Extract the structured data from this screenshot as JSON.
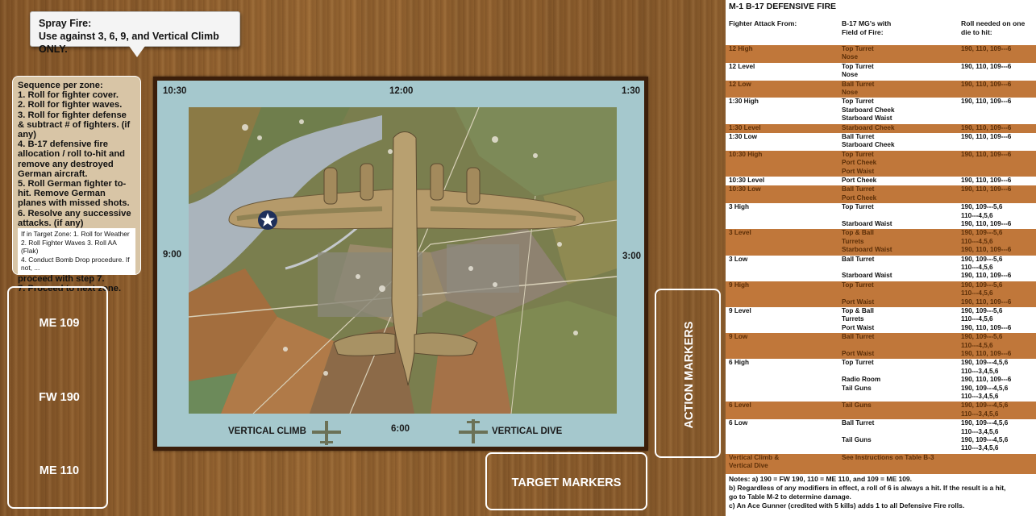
{
  "spray_fire": {
    "line1": "Spray Fire:",
    "line2": "Use against 3, 6, 9, and Vertical Climb ONLY."
  },
  "sequence": {
    "title": "Sequence per zone:",
    "steps": [
      "1. Roll for fighter cover.",
      "2. Roll for fighter waves.",
      "3. Roll for fighter defense & subtract # of fighters. (if any)",
      "4. B-17 defensive fire allocation / roll to-hit and remove any destroyed German aircraft.",
      "5. Roll German fighter to-hit. Remove German planes with missed shots.",
      "6. Resolve any successive attacks. (if any)"
    ],
    "sub": [
      "If in Target Zone:  1. Roll for Weather",
      "2. Roll Fighter Waves   3. Roll AA (Flak)",
      "4. Conduct Bomb Drop procedure. If not, ..."
    ],
    "after": [
      "proceed with step 7.",
      "7. Proceed to next zone."
    ]
  },
  "fighters": [
    "ME 109",
    "FW 190",
    "ME 110"
  ],
  "board": {
    "clock_1030": "10:30",
    "clock_1200": "12:00",
    "clock_130": "1:30",
    "clock_900": "9:00",
    "clock_300": "3:00",
    "clock_600": "6:00",
    "vertical_climb": "VERTICAL CLIMB",
    "vertical_dive": "VERTICAL DIVE"
  },
  "action_markers": "ACTION MARKERS",
  "target_markers": "TARGET MARKERS",
  "table": {
    "title": "M-1 B-17 DEFENSIVE FIRE",
    "headers": {
      "col1": "Fighter Attack From:",
      "col2a": "B-17 MG's with",
      "col2b": "Field of Fire:",
      "col3a": "Roll needed on one",
      "col3b": "die to hit:"
    },
    "rows": [
      {
        "style": "orange",
        "c1": "12 High",
        "c2": [
          "Top Turret",
          "Nose"
        ],
        "c3": [
          "190, 110, 109---6"
        ]
      },
      {
        "style": "white",
        "c1": "12 Level",
        "c2": [
          "Top Turret",
          "Nose"
        ],
        "c3": [
          "190, 110, 109---6"
        ]
      },
      {
        "style": "orange",
        "c1": "12 Low",
        "c2": [
          "Ball Turret",
          "Nose"
        ],
        "c3": [
          "190, 110, 109---6"
        ]
      },
      {
        "style": "white",
        "c1": "1:30 High",
        "c2": [
          "Top Turret",
          "Starboard Cheek",
          "Starboard Waist"
        ],
        "c3": [
          "190, 110, 109---6"
        ]
      },
      {
        "style": "orange",
        "c1": "1:30 Level",
        "c2": [
          "Starboard Cheek"
        ],
        "c3": [
          "190, 110, 109---6"
        ]
      },
      {
        "style": "white",
        "c1": "1:30 Low",
        "c2": [
          "Ball Turret",
          "Starboard Cheek"
        ],
        "c3": [
          "190, 110, 109---6"
        ]
      },
      {
        "style": "orange",
        "c1": "10:30 High",
        "c2": [
          "Top Turret",
          "Port Cheek",
          "Port Waist"
        ],
        "c3": [
          "190, 110, 109---6"
        ]
      },
      {
        "style": "white",
        "c1": "10:30 Level",
        "c2": [
          "Port Cheek"
        ],
        "c3": [
          "190, 110, 109---6"
        ]
      },
      {
        "style": "orange",
        "c1": "10:30 Low",
        "c2": [
          "Ball Turret",
          "Port Cheek"
        ],
        "c3": [
          "190, 110, 109---6"
        ]
      },
      {
        "style": "white",
        "c1": "3 High",
        "c2": [
          "Top Turret",
          "",
          "Starboard Waist"
        ],
        "c3": [
          "190, 109---5,6",
          "110---4,5,6",
          "190, 110, 109---6"
        ]
      },
      {
        "style": "orange",
        "c1": "3 Level",
        "c2": [
          "Top & Ball",
          "Turrets",
          "Starboard Waist"
        ],
        "c3": [
          "190, 109---5,6",
          "110---4,5,6",
          "190, 110, 109---6"
        ]
      },
      {
        "style": "white",
        "c1": "3 Low",
        "c2": [
          "Ball Turret",
          "",
          "Starboard Waist"
        ],
        "c3": [
          "190, 109---5,6",
          "110---4,5,6",
          "190, 110, 109---6"
        ]
      },
      {
        "style": "orange",
        "c1": "9 High",
        "c2": [
          "Top Turret",
          "",
          "Port Waist"
        ],
        "c3": [
          "190, 109---5,6",
          "110---4,5,6",
          "190, 110, 109---6"
        ]
      },
      {
        "style": "white",
        "c1": "9 Level",
        "c2": [
          "Top & Ball",
          "Turrets",
          "Port Waist"
        ],
        "c3": [
          "190, 109---5,6",
          "110---4,5,6",
          "190, 110, 109---6"
        ]
      },
      {
        "style": "orange",
        "c1": "9 Low",
        "c2": [
          "Ball Turret",
          "",
          "Port Waist"
        ],
        "c3": [
          "190, 109---5,6",
          "110---4,5,6",
          "190, 110, 109---6"
        ]
      },
      {
        "style": "white",
        "c1": "6 High",
        "c2": [
          "Top Turret",
          "",
          "Radio Room",
          "Tail Guns",
          ""
        ],
        "c3": [
          "190, 109---4,5,6",
          "110---3,4,5,6",
          "190, 110, 109---6",
          "190, 109---4,5,6",
          "110---3,4,5,6"
        ]
      },
      {
        "style": "orange",
        "c1": "6 Level",
        "c2": [
          "Tail Guns"
        ],
        "c3": [
          "190, 109---4,5,6",
          "110---3,4,5,6"
        ]
      },
      {
        "style": "white",
        "c1": "6 Low",
        "c2": [
          "Ball Turret",
          "",
          "Tail Guns",
          ""
        ],
        "c3": [
          "190, 109---4,5,6",
          "110---3,4,5,6",
          "190, 109---4,5,6",
          "110---3,4,5,6"
        ]
      },
      {
        "style": "orange",
        "c1": "Vertical Climb &\nVertical Dive",
        "c2": [
          "See Instructions on Table B-3"
        ],
        "c3": [
          ""
        ]
      }
    ],
    "notes": [
      "Notes: a) 190 = FW 190, 110 = ME 110, and 109 = ME 109.",
      "b) Regardless of any modifiers in effect, a roll of 6 is always a hit. If the result is a hit,",
      "go to Table M-2 to determine damage.",
      "c) An Ace Gunner (credited with 5 kills) adds 1 to all Defensive Fire rolls."
    ]
  }
}
